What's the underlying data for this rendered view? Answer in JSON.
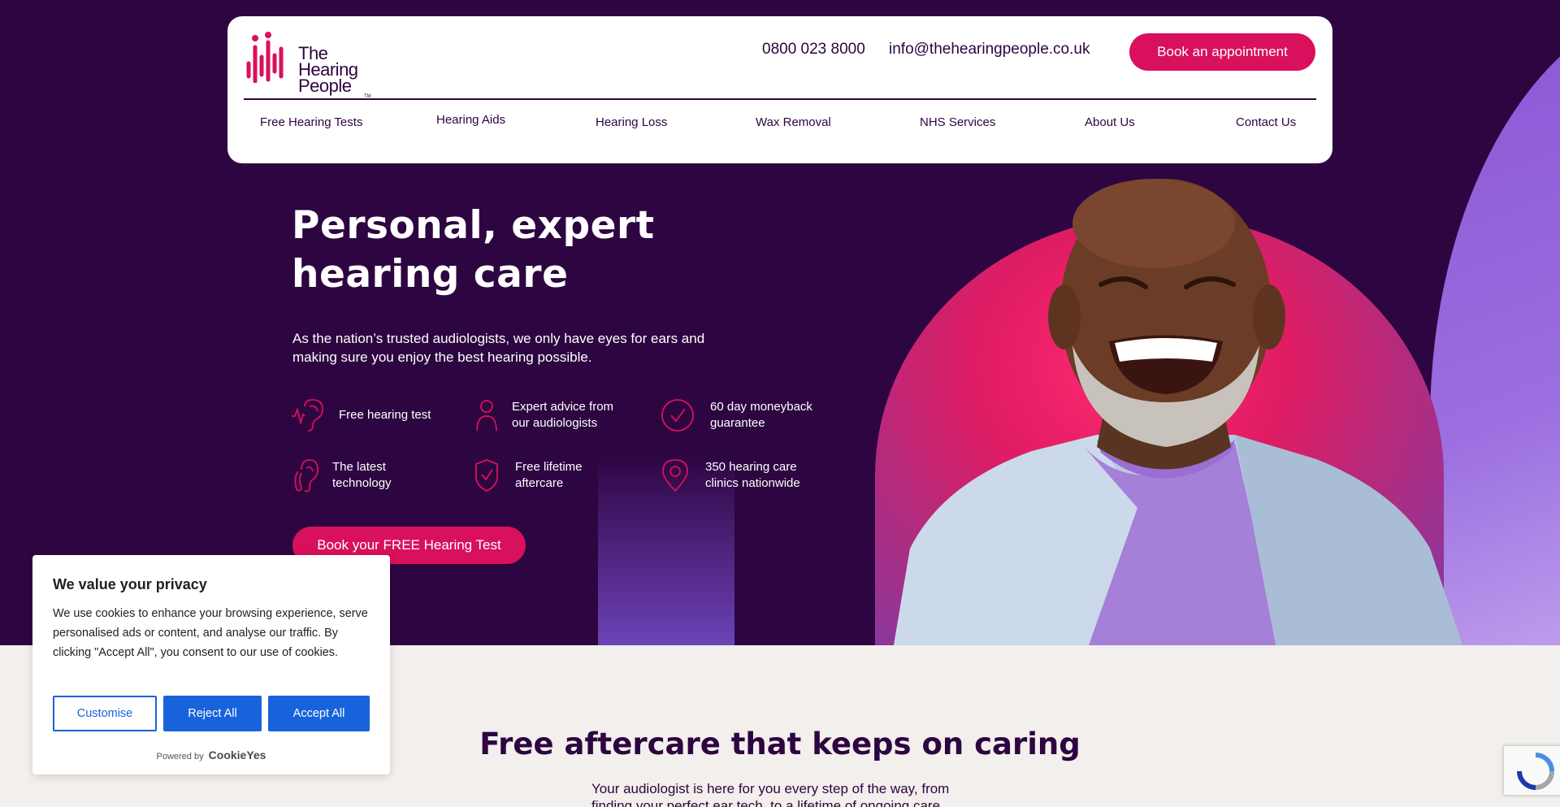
{
  "header": {
    "logo": {
      "line1": "The",
      "line2": "Hearing",
      "line3": "People",
      "tm": "TM"
    },
    "phone": "0800 023 8000",
    "email": "info@thehearingpeople.co.uk",
    "book_button": "Book an appointment",
    "nav": [
      {
        "label": "Free Hearing Tests"
      },
      {
        "label": "Hearing Aids"
      },
      {
        "label": "Hearing Loss"
      },
      {
        "label": "Wax Removal"
      },
      {
        "label": "NHS Services"
      },
      {
        "label": "About Us"
      },
      {
        "label": "Contact Us"
      }
    ]
  },
  "hero": {
    "title": "Personal, expert hearing care",
    "subtitle": "As the nation’s trusted audiologists, we only have eyes for ears and making sure you enjoy the best hearing possible.",
    "features": [
      {
        "icon": "ear-soundwave-icon",
        "text": "Free hearing test"
      },
      {
        "icon": "person-icon",
        "text": "Expert advice from\nour audiologists"
      },
      {
        "icon": "check-circle-icon",
        "text": "60 day moneyback\nguarantee"
      },
      {
        "icon": "hearing-aid-icon",
        "text": "The latest\ntechnology"
      },
      {
        "icon": "shield-check-icon",
        "text": "Free lifetime\naftercare"
      },
      {
        "icon": "location-pin-icon",
        "text": "350 hearing care\nclinics nationwide"
      }
    ],
    "cta": "Book your FREE Hearing Test"
  },
  "section": {
    "title": "Free aftercare that keeps on caring",
    "subtitle": "Your audiologist is here for you every step of the way, from finding your perfect ear tech, to a lifetime of ongoing care."
  },
  "cookie_banner": {
    "title": "We value your privacy",
    "body": "We use cookies to enhance your browsing experience, serve personalised ads or content, and analyse our traffic. By clicking \"Accept All\", you consent to our use of cookies.",
    "customise": "Customise",
    "reject": "Reject All",
    "accept": "Accept All",
    "powered_by": "Powered by",
    "brand": "CookieYes"
  },
  "colors": {
    "brand_purple": "#2d0541",
    "brand_pink": "#d9105c",
    "cookie_blue": "#1863dc"
  }
}
